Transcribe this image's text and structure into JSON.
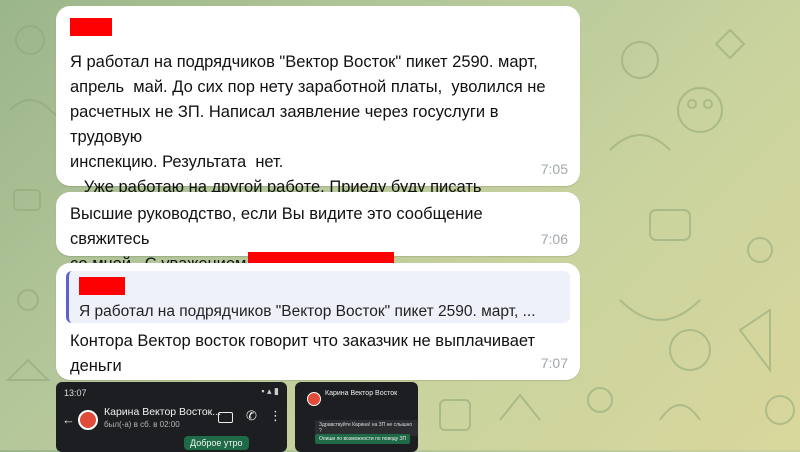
{
  "messages": [
    {
      "text": "Я работал на подрядчиков \"Вектор Восток\" пикет 2590. март,\nапрель  май. До сих пор нету заработной платы,  уволился не\nрасчетных не ЗП. Написал заявление через госуслуги в трудовую\nинспекцию. Результата  нет.\n   Уже работаю на другой работе. Приеду буду писать заявление\nв суд .",
      "time": "7:05"
    },
    {
      "text": "Высшие руководство, если Вы видите это сообщение свяжитесь\nсо мной . С уважением",
      "time": "7:06"
    },
    {
      "reply_preview": "Я работал на подрядчиков \"Вектор Восток\" пикет 2590. март, ...",
      "text": "Контора Вектор восток говорит что заказчик не выплачивает\nденьги",
      "time": "7:07"
    }
  ],
  "screenshot1": {
    "status_time": "13:07",
    "contact_name": "Карина Вектор Восток...",
    "contact_status": "был(-а) в сб. в 02:00",
    "chat_message": "Доброе утро"
  },
  "screenshot2": {
    "contact_name": "Карина Вектор Восток",
    "message1": "Здравствуйте Карина! на ЗП не слышно ?",
    "message2": "Опиши по возможности по поводу ЗП"
  },
  "colors": {
    "redaction": "#ff0000",
    "reply_accent": "#5b63c9",
    "bubble": "#ffffff",
    "time": "#a0a8ac"
  }
}
